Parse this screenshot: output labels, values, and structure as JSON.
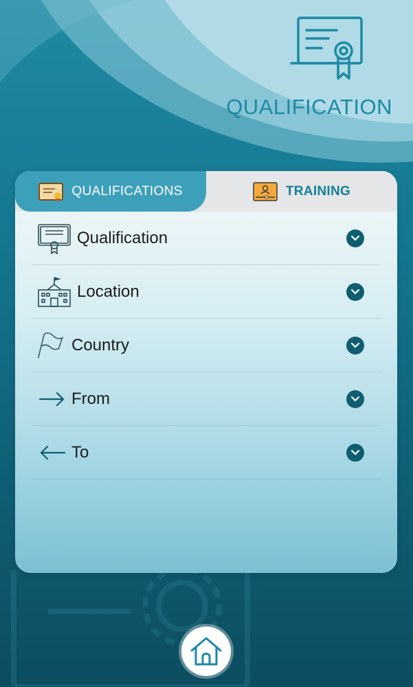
{
  "header": {
    "title": "QUALIFICATION",
    "icon": "certificate-award-icon"
  },
  "tabs": [
    {
      "label": "QUALIFICATIONS",
      "icon": "certificate-icon",
      "active": true
    },
    {
      "label": "TRAINING",
      "icon": "video-training-icon",
      "active": false
    }
  ],
  "fields": [
    {
      "label": "Qualification",
      "icon": "diploma-icon"
    },
    {
      "label": "Location",
      "icon": "school-building-icon"
    },
    {
      "label": "Country",
      "icon": "flag-icon"
    },
    {
      "label": "From",
      "icon": "arrow-right-icon"
    },
    {
      "label": "To",
      "icon": "arrow-left-icon"
    }
  ],
  "footer": {
    "home_icon": "home-icon"
  },
  "colors": {
    "accent": "#3da0bb",
    "title": "#1d8aa3",
    "chevron": "#0f5d70",
    "background_dark": "#0c4d60"
  }
}
